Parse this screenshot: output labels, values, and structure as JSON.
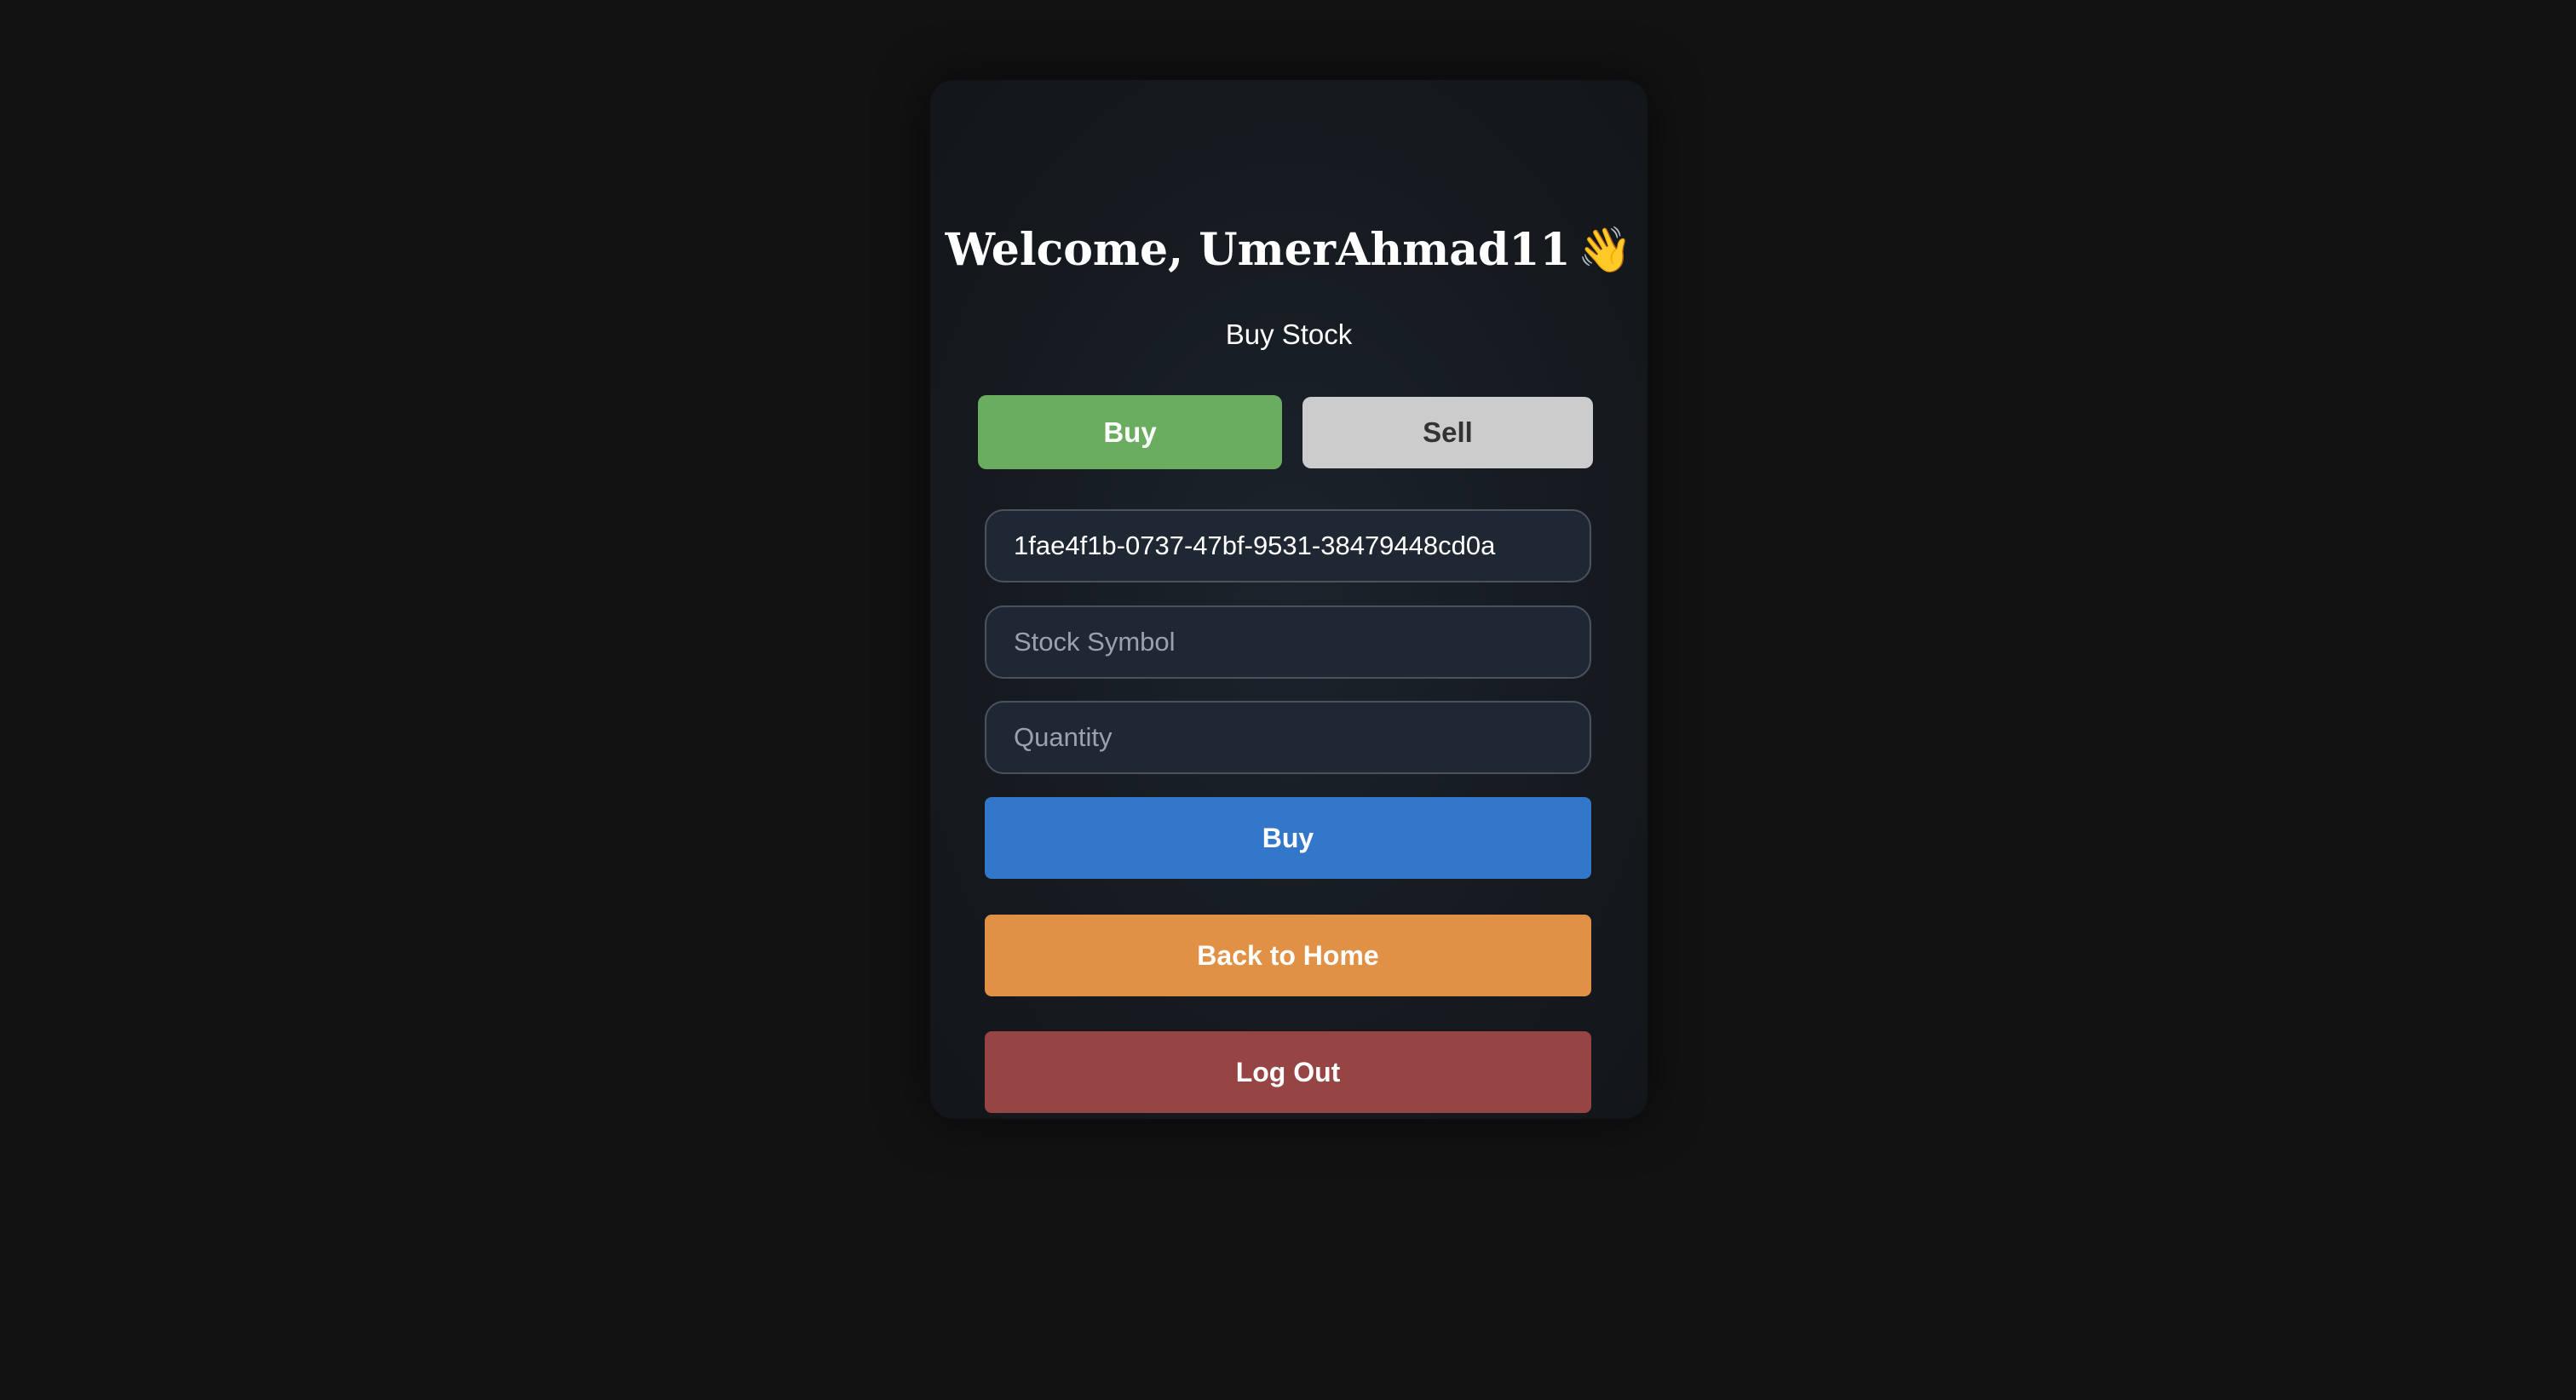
{
  "welcome": {
    "title": "Welcome, UmerAhmad11",
    "emoji": "👋"
  },
  "subtitle": "Buy Stock",
  "mode_toggle": {
    "buy_label": "Buy",
    "sell_label": "Sell",
    "active": "Buy"
  },
  "form": {
    "user_id_value": "1fae4f1b-0737-47bf-9531-38479448cd0a",
    "stock_symbol_placeholder": "Stock Symbol",
    "quantity_placeholder": "Quantity",
    "submit_label": "Buy"
  },
  "nav": {
    "back_home_label": "Back to Home",
    "logout_label": "Log Out"
  },
  "colors": {
    "page_background": "#121212",
    "buy_toggle": "#6aad5e",
    "sell_toggle": "#cccccc",
    "submit": "#3377c9",
    "back_home": "#e09146",
    "logout": "#974444"
  }
}
